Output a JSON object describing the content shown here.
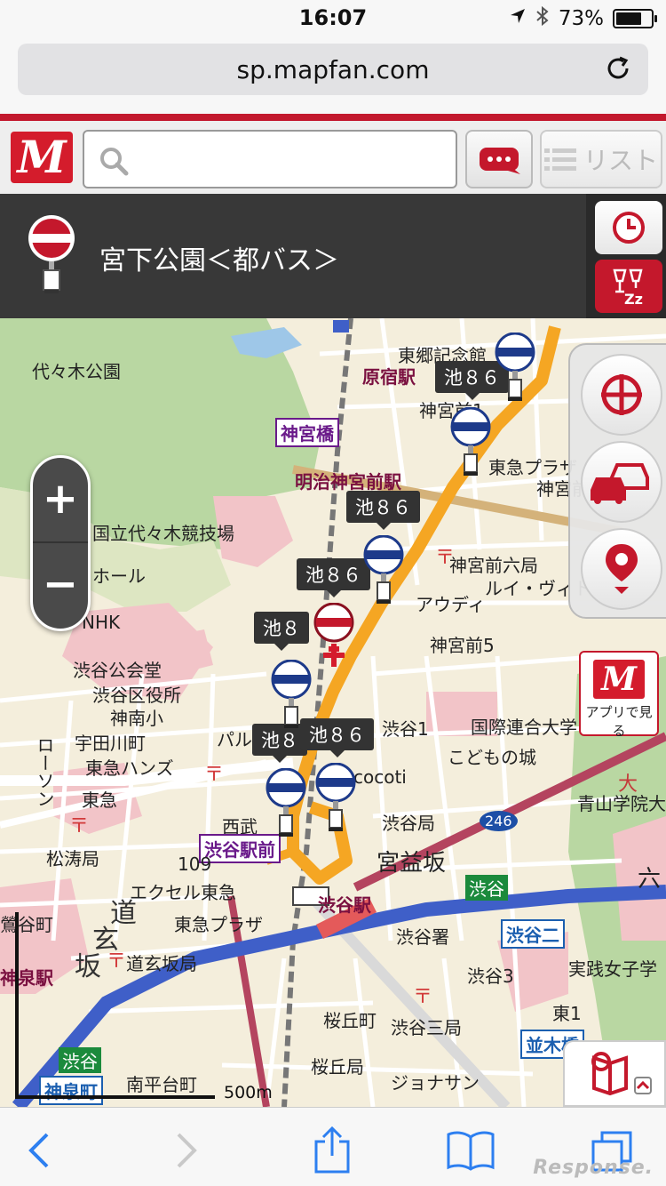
{
  "status_bar": {
    "time": "16:07",
    "battery": "73%",
    "battery_level": 0.73
  },
  "browser": {
    "url": "sp.mapfan.com"
  },
  "header": {
    "logo": "M",
    "search_placeholder": "",
    "list_label": "リスト"
  },
  "selected_stop": {
    "name": "宮下公園＜都バス＞"
  },
  "map": {
    "route_label": "池８６",
    "route_label_partial": "池８",
    "route_label_short": "池８",
    "labels": {
      "yoyogi_park": "代々木公園",
      "harajuku": "原宿駅",
      "jingu_bashi": "神宮橋",
      "meiji_jingumae": "明治神宮前駅",
      "togo_kinenkan": "東郷記念館",
      "jingumae1": "神宮前1",
      "tokyu_plaza_1": "東急プラザ",
      "jingumae_b": "神宮前",
      "kokuritsu": "国立代々木競技場",
      "hall": "ホール",
      "nhk": "NHK",
      "jingumae6": "神宮前六局",
      "louis": "ルイ・ヴィトン",
      "audi": "アウディ",
      "jingumae5": "神宮前5",
      "koukaido": "渋谷公会堂",
      "kuyakusho": "渋谷区役所",
      "jinnan_sho": "神南小",
      "udagawa": "宇田川町",
      "parco": "パルコ",
      "tokyu_hands": "東急ハンズ",
      "lawson": "ローソン",
      "tokyu_d": "東急",
      "shoto": "松涛局",
      "seibu": "西武",
      "shibuya_ekimae": "渋谷駅前",
      "n109": "109",
      "excel": "エクセル東急",
      "tokyu_plaza_2": "東急プラザ",
      "dogen": "道玄坂局",
      "shibuya_sta": "渋谷駅",
      "kokuren": "国際連合大学",
      "kodomo": "こどもの城",
      "cocoti": "cocoti",
      "shibuya1": "渋谷1",
      "shibuyakyoku": "渋谷局",
      "miyamasu": "宮益坂",
      "aoyama": "青山学院大",
      "r246": "246",
      "shibuya_sign": "渋谷",
      "shibuyasho": "渋谷署",
      "shibuya2": "渋谷二",
      "jissen": "実践女子学",
      "shibuya3": "渋谷3",
      "higashi1": "東1",
      "sakuragaoka": "桜丘町",
      "shibuya3kyoku": "渋谷三局",
      "namiki": "並木橋",
      "sakuragaokakyoku": "桜丘局",
      "jonathan": "ジョナサン",
      "nanpeidai": "南平台町",
      "shinsen": "神泉町",
      "shibuya_sign2": "渋谷",
      "shinsen_sta": "神泉駅",
      "uguisudani": "鶯谷町",
      "dougen_big": "道",
      "gen_big": "玄",
      "zaka_big": "坂",
      "daitai": "大",
      "roku": "六"
    },
    "scale_label": "500m",
    "app_button_label": "アプリで見る",
    "colors": {
      "route": "#f5a623",
      "road_major": "#3a5fcd",
      "park": "#b8d9a0",
      "pink": "#f2b8bd"
    }
  },
  "toolbar": {
    "watermark": "Response."
  }
}
